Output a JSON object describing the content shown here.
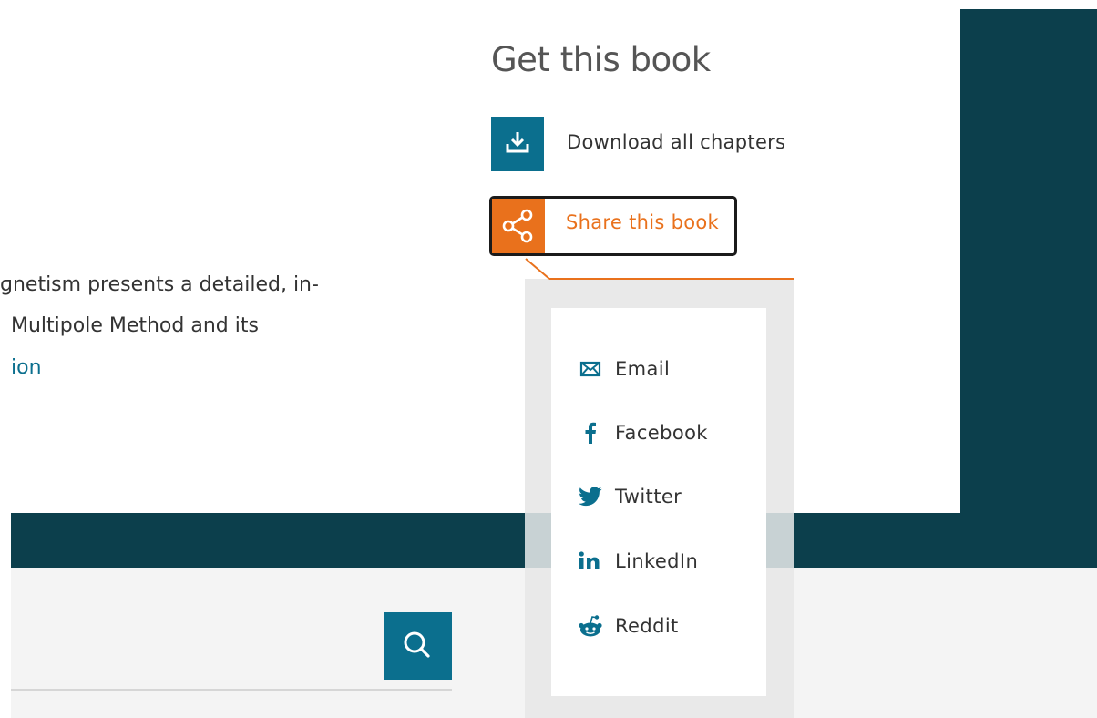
{
  "get_book": {
    "title": "Get this book",
    "download_label": "Download all chapters",
    "share_label": "Share this book"
  },
  "description": {
    "line1": "ɡnetism presents a detailed, in-",
    "line2": "Multipole Method and its",
    "link_fragment": "ion"
  },
  "share_menu": {
    "items": [
      {
        "label": "Email",
        "icon": "email-icon"
      },
      {
        "label": "Facebook",
        "icon": "facebook-icon"
      },
      {
        "label": "Twitter",
        "icon": "twitter-icon"
      },
      {
        "label": "LinkedIn",
        "icon": "linkedin-icon"
      },
      {
        "label": "Reddit",
        "icon": "reddit-icon"
      }
    ]
  },
  "colors": {
    "brand_teal": "#0c3f4c",
    "action_blue": "#0b6f8e",
    "accent_orange": "#e9711c"
  }
}
